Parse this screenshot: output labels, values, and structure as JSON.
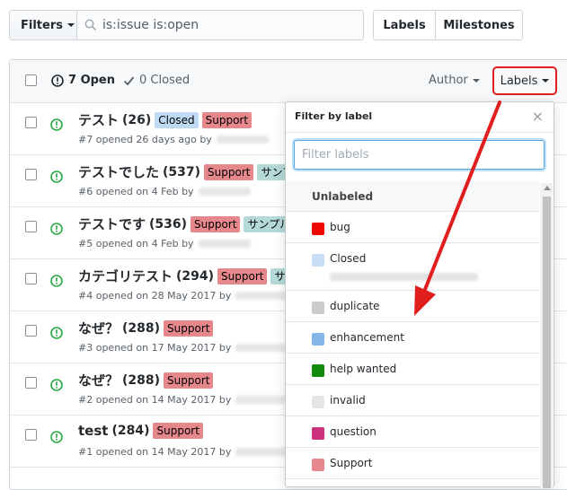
{
  "toolbar": {
    "filters_label": "Filters",
    "search_value": "is:issue is:open",
    "labels_tab": "Labels",
    "milestones_tab": "Milestones"
  },
  "header": {
    "open_count": "7 Open",
    "closed_count": "0 Closed",
    "author_sort": "Author",
    "labels_sort": "Labels"
  },
  "issues": [
    {
      "title": "テスト",
      "count": "(26)",
      "labels": [
        "Closed",
        "Support"
      ],
      "meta": "#7 opened 26 days ago by"
    },
    {
      "title": "テストでした",
      "count": "(537)",
      "labels": [
        "Support",
        "サンプ"
      ],
      "meta": "#6 opened on 4 Feb by"
    },
    {
      "title": "テストです",
      "count": "(536)",
      "labels": [
        "Support",
        "サンプル"
      ],
      "meta": "#5 opened on 4 Feb by"
    },
    {
      "title": "カテゴリテスト",
      "count": "(294)",
      "labels": [
        "Support",
        "サ"
      ],
      "meta": "#4 opened on 28 May 2017 by"
    },
    {
      "title": "なぜ？",
      "count": "(288)",
      "labels": [
        "Support"
      ],
      "meta": "#3 opened on 17 May 2017 by"
    },
    {
      "title": "なぜ？",
      "count": "(288)",
      "labels": [
        "Support"
      ],
      "meta": "#2 opened on 14 May 2017 by"
    },
    {
      "title": "test",
      "count": "(284)",
      "labels": [
        "Support"
      ],
      "meta": "#1 opened on 14 May 2017 by"
    }
  ],
  "dropdown": {
    "title": "Filter by label",
    "close_glyph": "×",
    "filter_placeholder": "Filter labels",
    "unlabeled": "Unlabeled",
    "items": [
      {
        "name": "bug",
        "color": "#ee0701"
      },
      {
        "name": "Closed",
        "color": "#c5def5"
      },
      {
        "name": "duplicate",
        "color": "#cccccc"
      },
      {
        "name": "enhancement",
        "color": "#84b6eb"
      },
      {
        "name": "help wanted",
        "color": "#128a0c"
      },
      {
        "name": "invalid",
        "color": "#e6e6e6"
      },
      {
        "name": "question",
        "color": "#cc317c"
      },
      {
        "name": "Support",
        "color": "#e6878b"
      }
    ]
  },
  "colors": {
    "annotation_red": "#e01e1e",
    "open_green": "#28a745"
  }
}
